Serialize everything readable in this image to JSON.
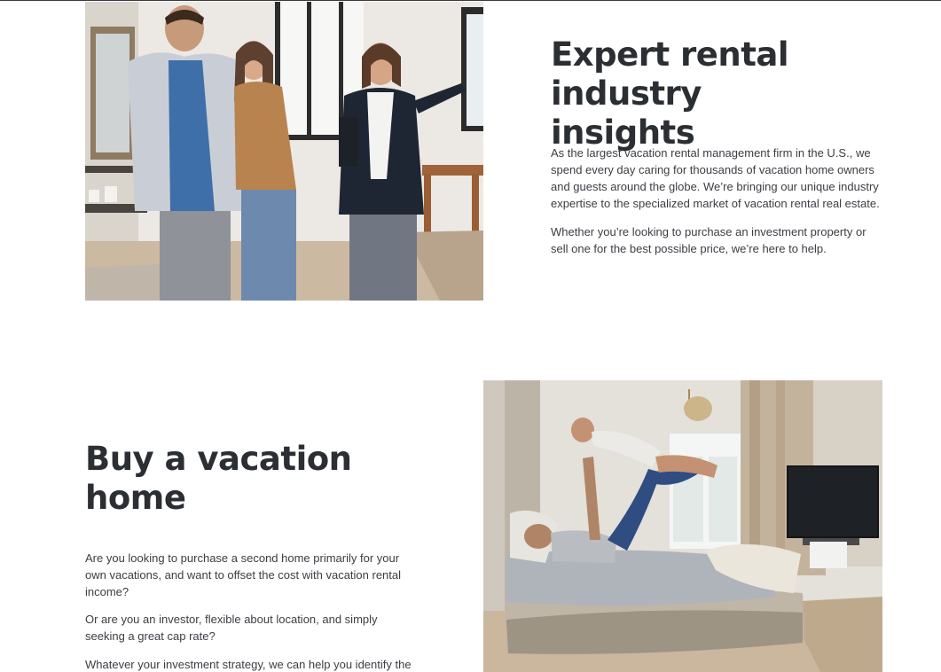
{
  "section_insights": {
    "title": "Expert rental industry insights",
    "paragraph_1": "As the largest vacation rental management firm in the U.S., we spend every day caring for thousands of vacation home owners and guests around the globe. We’re bringing our unique industry expertise to the specialized market of vacation rental real estate.",
    "paragraph_2": "Whether you’re looking to purchase an investment property or sell one for the best possible price, we’re here to help."
  },
  "section_buy": {
    "title": "Buy a vacation home",
    "paragraph_1": "Are you looking to purchase a second home primarily for your own vacations, and want to offset the cost with vacation rental income?",
    "paragraph_2": "Or are you an investor, flexible about location, and simply seeking a great cap rate?",
    "paragraph_3": "Whatever your investment strategy, we can help you identify the"
  }
}
